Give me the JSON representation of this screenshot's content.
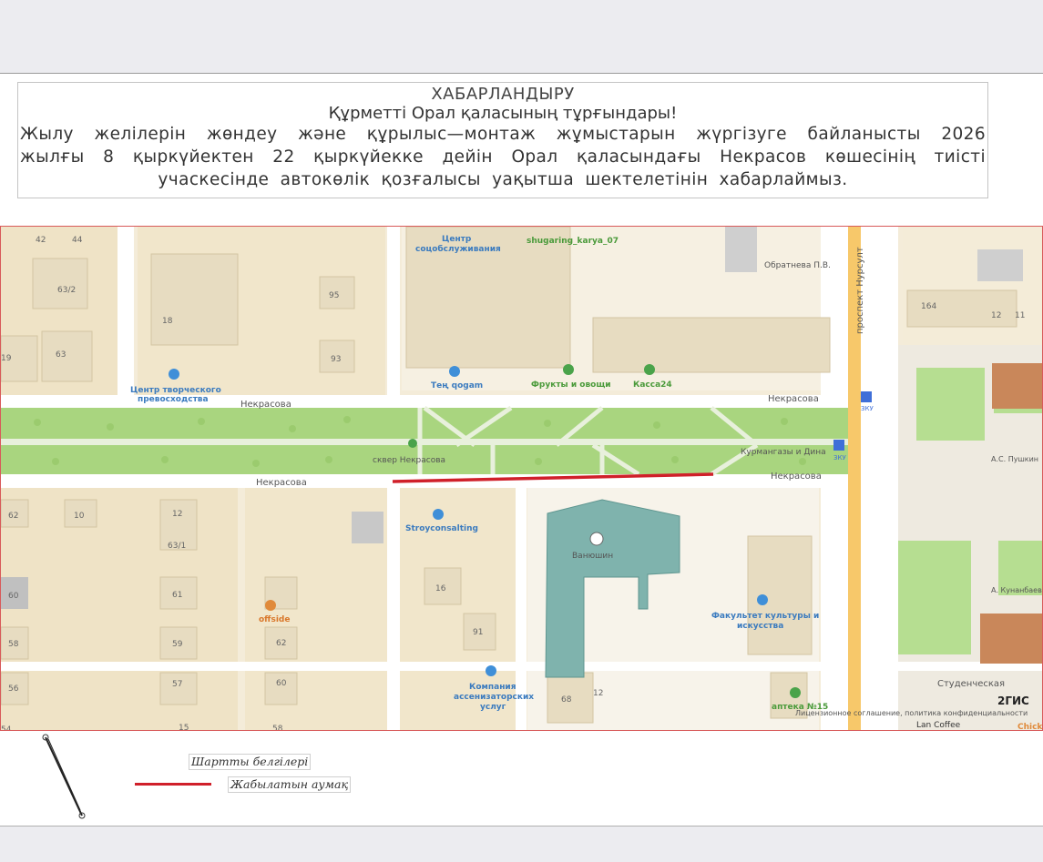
{
  "notice": {
    "title": "ХАБАРЛАНДЫРУ",
    "greeting": "Құрметті Орал қаласының тұрғындары!",
    "body": "Жылу желілерін жөндеу және құрылыс—монтаж жұмыстарын жүргізуге байланысты 2026 жылғы 8 қыркүйектен 22 қыркүйекке дейін Орал қаласындағы Некрасов көшесінің тиісті учаскесінде автокөлік қозғалысы уақытша шектелетінін хабарлаймыз."
  },
  "map": {
    "streets": {
      "nekrasova_top_left": "Некрасова",
      "nekrasova_top_right": "Некрасова",
      "nekrasova_bottom_left": "Некрасова",
      "nekrasova_bottom_right": "Некрасова",
      "nursultan": "проспект Нурсулт",
      "studencheskaya": "Студенческая"
    },
    "pois": {
      "creative_center_1": "Центр творческого",
      "creative_center_2": "превосходства",
      "social_center_1": "Центр",
      "social_center_2": "соцобслуживания",
      "shugaring": "shugaring_karya_07",
      "obratneva": "Обратнева П.В.",
      "ten_qogam": "Тең qogam",
      "fruits": "Фрукты и овощи",
      "kassa": "Касса24",
      "square": "сквер Некрасова",
      "kurmangazy": "Курмангазы и Дина",
      "stroyconsalting": "Stroyconsalting",
      "vanyushin": "Ванюшин",
      "offside": "offside",
      "faculty_1": "Факультет культуры и",
      "faculty_2": "искусства",
      "asenizator_1": "Компания",
      "asenizator_2": "ассенизаторских",
      "asenizator_3": "услуг",
      "apteka": "аптека №15",
      "pushkin": "А.С. Пушкин",
      "kunanbaev": "А. Кунанбаев",
      "bus_stop_1": "ЗКУ",
      "bus_stop_2": "ЗКУ",
      "lan_coffee": "Lan Coffee",
      "chick": "Chick",
      "twogis": "2ГИС",
      "license": "Лицензионное соглашение, политика конфиденциальности"
    },
    "house_numbers": {
      "h63_2": "63/2",
      "h18": "18",
      "h95": "95",
      "h93": "93",
      "h19": "19",
      "h63": "63",
      "h164": "164",
      "h62a": "62",
      "h10": "10",
      "h12": "12",
      "h63_1": "63/1",
      "h60a": "60",
      "h61": "61",
      "h16": "16",
      "h91": "91",
      "h58": "58",
      "h59": "59",
      "h62b": "62",
      "h56": "56",
      "h57": "57",
      "h60b": "60",
      "h15": "15",
      "h68": "68",
      "h58b": "58",
      "h54": "54",
      "h42": "42",
      "h44": "44",
      "h12r": "12",
      "h11": "11",
      "h12b": "12"
    }
  },
  "legend": {
    "title": "Шартты белгілері",
    "closed_area": "Жабылатын аумақ",
    "closed_color": "#d0202a"
  }
}
